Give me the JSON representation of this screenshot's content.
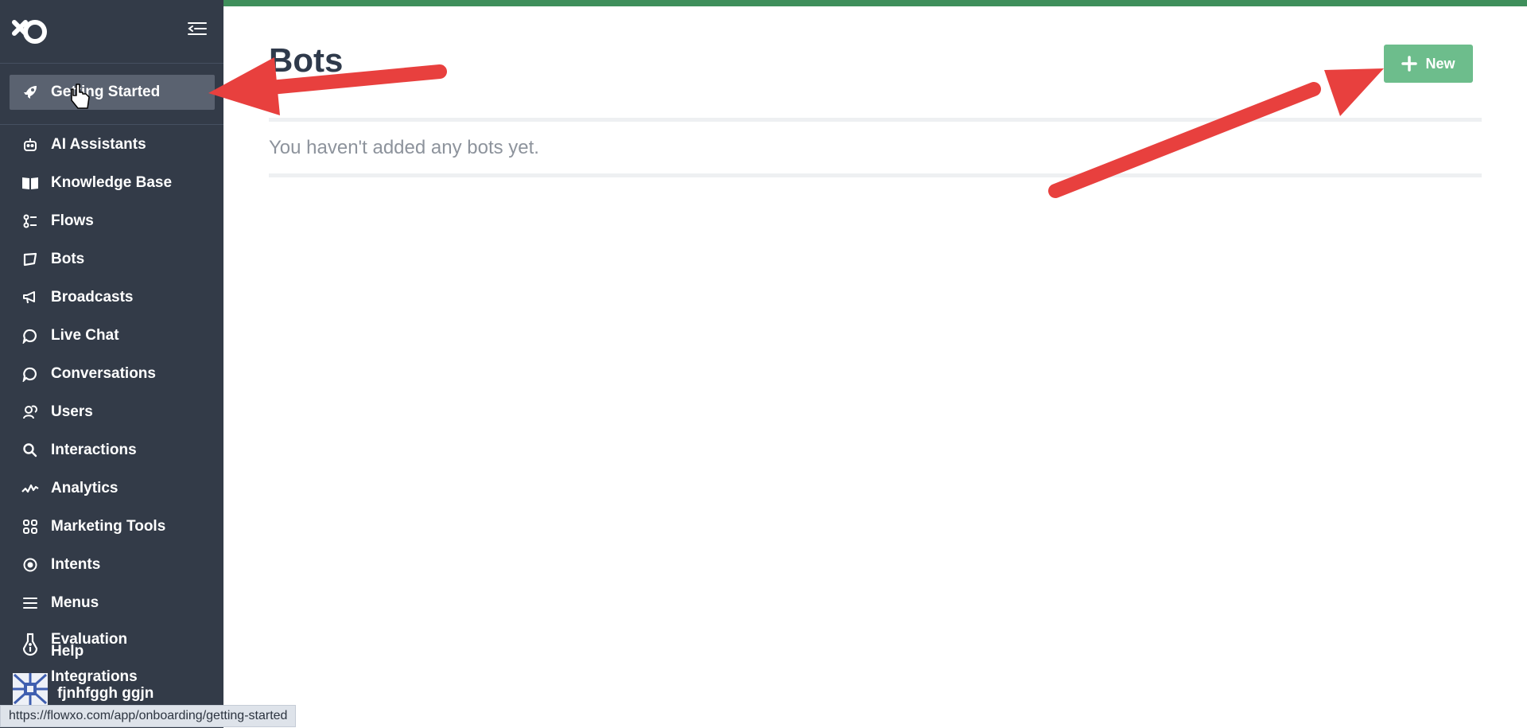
{
  "sidebar": {
    "logo": "flowxo-logo",
    "collapse_icon": "collapse-menu-icon",
    "active_item": "Getting Started",
    "items": [
      {
        "label": "Getting Started",
        "icon": "rocket-icon"
      },
      {
        "label": "AI Assistants",
        "icon": "robot-icon"
      },
      {
        "label": "Knowledge Base",
        "icon": "book-icon"
      },
      {
        "label": "Flows",
        "icon": "flows-icon"
      },
      {
        "label": "Bots",
        "icon": "bots-icon"
      },
      {
        "label": "Broadcasts",
        "icon": "megaphone-icon"
      },
      {
        "label": "Live Chat",
        "icon": "chat-bubble-icon"
      },
      {
        "label": "Conversations",
        "icon": "chat-bubble-icon"
      },
      {
        "label": "Users",
        "icon": "users-icon"
      },
      {
        "label": "Interactions",
        "icon": "search-icon"
      },
      {
        "label": "Analytics",
        "icon": "analytics-icon"
      },
      {
        "label": "Marketing Tools",
        "icon": "grid-icon"
      },
      {
        "label": "Intents",
        "icon": "intents-icon"
      },
      {
        "label": "Menus",
        "icon": "menu-lines-icon"
      }
    ],
    "evaluation": {
      "label": "Evaluation",
      "icon": "flask-icon"
    },
    "help": {
      "label": "Help"
    },
    "integrations": {
      "label": "Integrations"
    },
    "user_name": "fjnhfggh ggjn"
  },
  "main": {
    "title": "Bots",
    "new_button": "New",
    "empty_message": "You haven't added any bots yet."
  },
  "status_bar": "https://flowxo.com/app/onboarding/getting-started",
  "colors": {
    "sidebar_bg": "#333b48",
    "active_item_bg": "#5a6270",
    "accent_green": "#3f8f5b",
    "new_button_bg": "#6dbd8c",
    "annotation_arrow": "#e8403e"
  }
}
